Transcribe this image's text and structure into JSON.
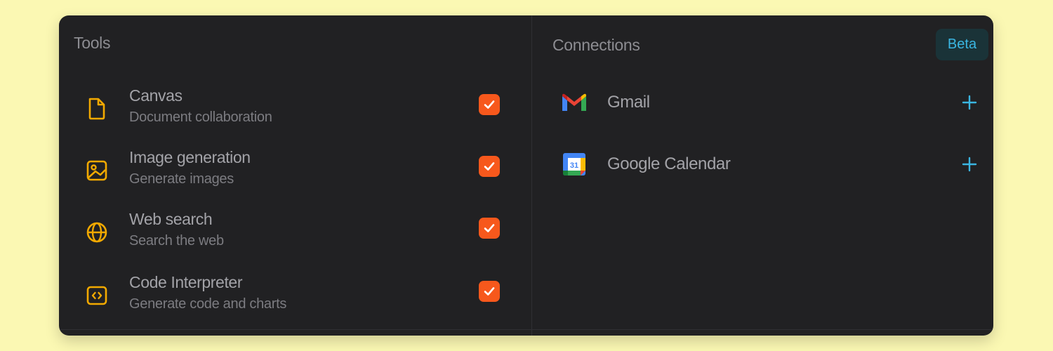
{
  "tools": {
    "title": "Tools",
    "items": [
      {
        "name": "Canvas",
        "description": "Document collaboration",
        "icon": "document-icon",
        "checked": true
      },
      {
        "name": "Image generation",
        "description": "Generate images",
        "icon": "image-icon",
        "checked": true
      },
      {
        "name": "Web search",
        "description": "Search the web",
        "icon": "globe-icon",
        "checked": true
      },
      {
        "name": "Code Interpreter",
        "description": "Generate code and charts",
        "icon": "code-icon",
        "checked": true
      }
    ]
  },
  "connections": {
    "title": "Connections",
    "badge": "Beta",
    "items": [
      {
        "name": "Gmail",
        "icon": "gmail-icon",
        "action": "plus-icon"
      },
      {
        "name": "Google Calendar",
        "icon": "google-calendar-icon",
        "calendar_day": "31",
        "action": "plus-icon"
      }
    ]
  },
  "colors": {
    "page_background": "#fbf8b3",
    "panel_background": "#212123",
    "tool_icon": "#f2a900",
    "checkbox": "#f7581c",
    "badge_text": "#3ab6e2",
    "badge_background": "#1a3338",
    "plus": "#3ab6e2"
  }
}
